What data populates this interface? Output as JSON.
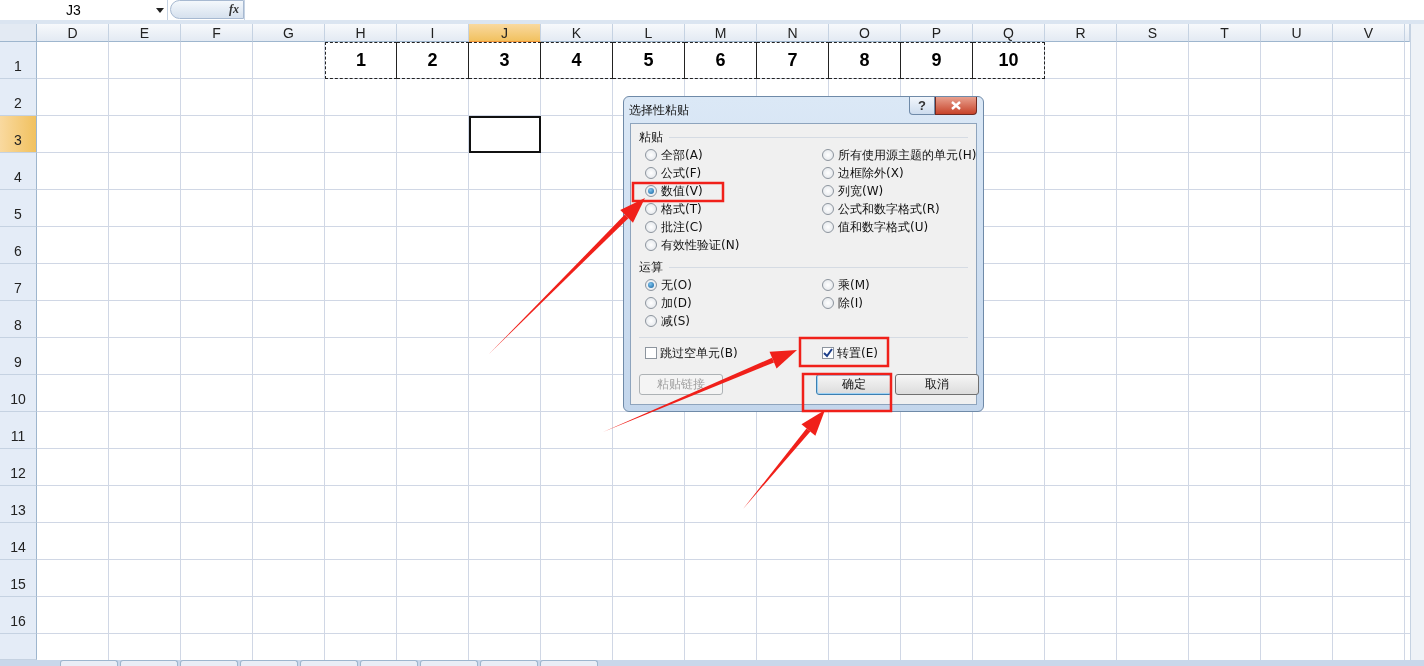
{
  "formula_bar": {
    "name_box": "J3",
    "fx": "fx"
  },
  "sheet": {
    "columns": [
      {
        "label": "D",
        "selected": false,
        "copied": false
      },
      {
        "label": "E",
        "selected": false,
        "copied": false
      },
      {
        "label": "F",
        "selected": false,
        "copied": false
      },
      {
        "label": "G",
        "selected": false,
        "copied": false
      },
      {
        "label": "H",
        "selected": false,
        "copied": true
      },
      {
        "label": "I",
        "selected": false,
        "copied": true
      },
      {
        "label": "J",
        "selected": true,
        "copied": true
      },
      {
        "label": "K",
        "selected": false,
        "copied": true
      },
      {
        "label": "L",
        "selected": false,
        "copied": true
      },
      {
        "label": "M",
        "selected": false,
        "copied": true
      },
      {
        "label": "N",
        "selected": false,
        "copied": true
      },
      {
        "label": "O",
        "selected": false,
        "copied": true
      },
      {
        "label": "P",
        "selected": false,
        "copied": true
      },
      {
        "label": "Q",
        "selected": false,
        "copied": true
      },
      {
        "label": "R",
        "selected": false,
        "copied": false
      },
      {
        "label": "S",
        "selected": false,
        "copied": false
      },
      {
        "label": "T",
        "selected": false,
        "copied": false
      },
      {
        "label": "U",
        "selected": false,
        "copied": false
      },
      {
        "label": "V",
        "selected": false,
        "copied": false
      }
    ],
    "rows": [
      {
        "label": "1",
        "selected": false,
        "values": [
          "1",
          "2",
          "3",
          "4",
          "5",
          "6",
          "7",
          "8",
          "9",
          "10"
        ]
      },
      {
        "label": "2",
        "selected": false
      },
      {
        "label": "3",
        "selected": true
      },
      {
        "label": "4",
        "selected": false
      },
      {
        "label": "5",
        "selected": false
      },
      {
        "label": "6",
        "selected": false
      },
      {
        "label": "7",
        "selected": false
      },
      {
        "label": "8",
        "selected": false
      },
      {
        "label": "9",
        "selected": false
      },
      {
        "label": "10",
        "selected": false
      },
      {
        "label": "11",
        "selected": false
      },
      {
        "label": "12",
        "selected": false
      },
      {
        "label": "13",
        "selected": false
      },
      {
        "label": "14",
        "selected": false
      },
      {
        "label": "15",
        "selected": false
      },
      {
        "label": "16",
        "selected": false
      }
    ]
  },
  "dialog": {
    "title": "选择性粘贴",
    "help": "?",
    "paste": {
      "label": "粘贴",
      "options": [
        {
          "label": "全部(A)",
          "selected": false
        },
        {
          "label": "公式(F)",
          "selected": false
        },
        {
          "label": "数值(V)",
          "selected": true
        },
        {
          "label": "格式(T)",
          "selected": false
        },
        {
          "label": "批注(C)",
          "selected": false
        },
        {
          "label": "有效性验证(N)",
          "selected": false
        },
        {
          "label": "所有使用源主题的单元(H)",
          "selected": false
        },
        {
          "label": "边框除外(X)",
          "selected": false
        },
        {
          "label": "列宽(W)",
          "selected": false
        },
        {
          "label": "公式和数字格式(R)",
          "selected": false
        },
        {
          "label": "值和数字格式(U)",
          "selected": false
        }
      ]
    },
    "operation": {
      "label": "运算",
      "options": [
        {
          "label": "无(O)",
          "selected": true
        },
        {
          "label": "加(D)",
          "selected": false
        },
        {
          "label": "减(S)",
          "selected": false
        },
        {
          "label": "乘(M)",
          "selected": false
        },
        {
          "label": "除(I)",
          "selected": false
        }
      ]
    },
    "checkboxes": [
      {
        "label": "跳过空单元(B)",
        "checked": false
      },
      {
        "label": "转置(E)",
        "checked": true
      }
    ],
    "buttons": [
      {
        "label": "粘贴链接",
        "disabled": true
      },
      {
        "label": "确定",
        "disabled": false
      },
      {
        "label": "取消",
        "disabled": false
      }
    ]
  }
}
